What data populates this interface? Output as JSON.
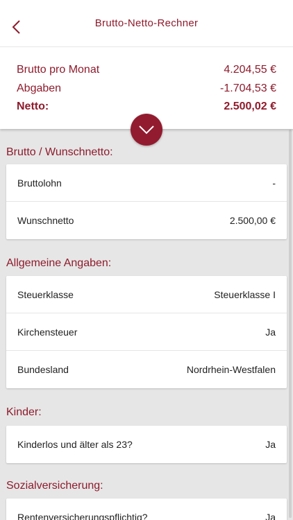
{
  "nav": {
    "title": "Brutto-Netto-Rechner"
  },
  "summary": {
    "rows": [
      {
        "label": "Brutto pro Monat",
        "value": "4.204,55 €"
      },
      {
        "label": "Abgaben",
        "value": "-1.704,53 €"
      },
      {
        "label": "Netto:",
        "value": "2.500,02 €"
      }
    ]
  },
  "sections": {
    "brutto": {
      "title": "Brutto / Wunschnetto:",
      "items": [
        {
          "label": "Bruttolohn",
          "value": "-"
        },
        {
          "label": "Wunschnetto",
          "value": "2.500,00 €"
        }
      ]
    },
    "allgemein": {
      "title": "Allgemeine Angaben:",
      "items": [
        {
          "label": "Steuerklasse",
          "value": "Steuerklasse I"
        },
        {
          "label": "Kirchensteuer",
          "value": "Ja"
        },
        {
          "label": "Bundesland",
          "value": "Nordrhein-Westfalen"
        }
      ]
    },
    "kinder": {
      "title": "Kinder:",
      "items": [
        {
          "label": "Kinderlos und älter als 23?",
          "value": "Ja"
        }
      ]
    },
    "sozial": {
      "title": "Sozialversicherung:",
      "items": [
        {
          "label": "Rentenversicherungspflichtig?",
          "value": "Ja"
        }
      ]
    }
  },
  "colors": {
    "accent": "#8e1b2c",
    "background": "#e6e6e6"
  }
}
